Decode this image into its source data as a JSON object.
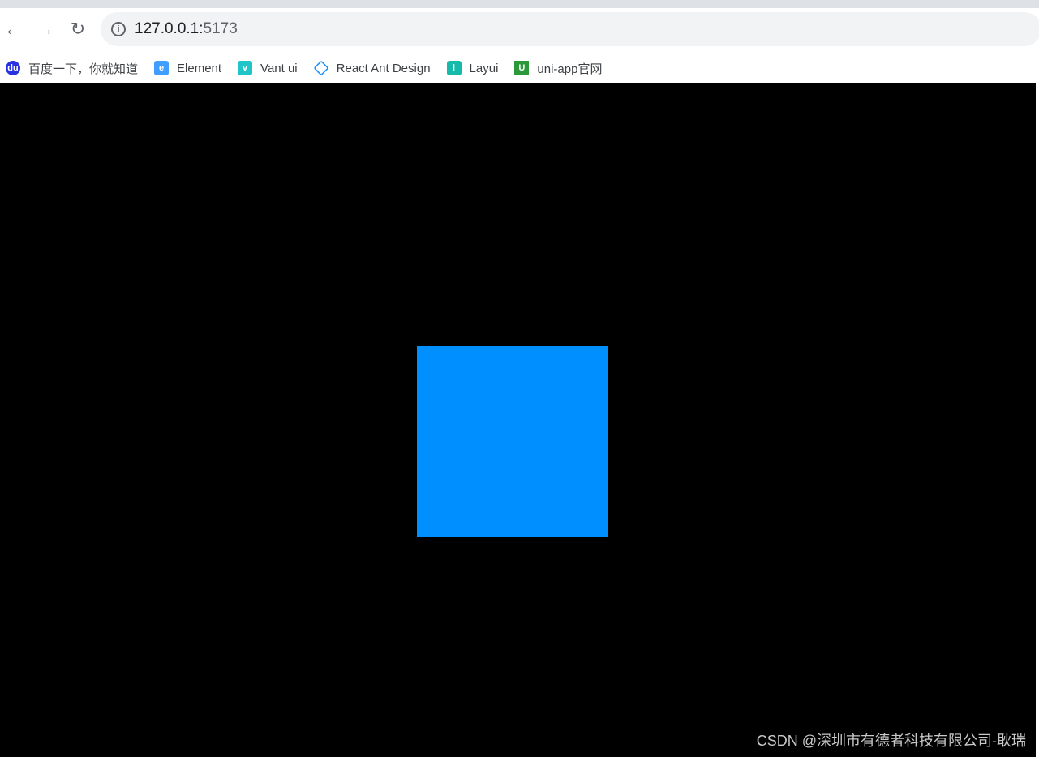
{
  "browser": {
    "url_host": "127.0.0.1:",
    "url_port": "5173",
    "bookmarks": [
      {
        "label": "百度一下，你就知道",
        "icon": "baidu-paw-icon",
        "color": "#2932e1"
      },
      {
        "label": "Element",
        "icon": "element-hexagon-icon",
        "color": "#409eff"
      },
      {
        "label": "Vant ui",
        "icon": "vant-icon",
        "color": "#1fc5c8"
      },
      {
        "label": "React Ant Design",
        "icon": "ant-design-diamond-icon",
        "color": "#1890ff"
      },
      {
        "label": "Layui",
        "icon": "layui-icon",
        "color": "#16baaa"
      },
      {
        "label": "uni-app官网",
        "icon": "uni-app-icon",
        "color": "#2b9939"
      }
    ]
  },
  "page": {
    "background": "#000000",
    "square_color": "#008fff",
    "watermark": "CSDN @深圳市有德者科技有限公司-耿瑞"
  }
}
